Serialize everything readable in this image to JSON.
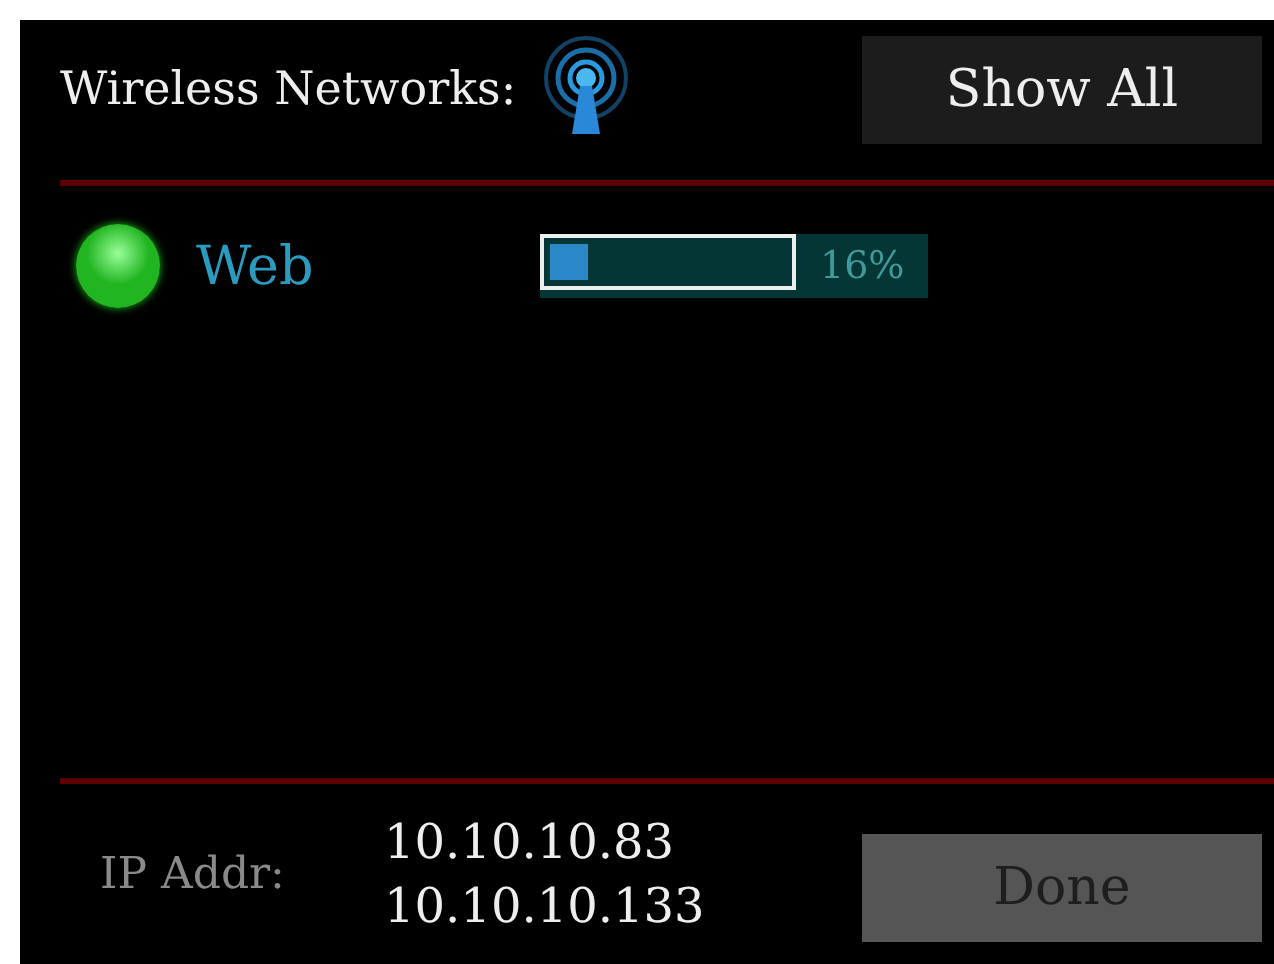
{
  "header": {
    "title": "Wireless Networks:",
    "button": "Show All"
  },
  "networks": [
    {
      "name": "Web",
      "color": "#22b522",
      "level": 0.16,
      "reading": "16%"
    }
  ],
  "footer": {
    "label": "IP Addr:",
    "addresses": [
      "10.10.10.83",
      "10.10.10.133"
    ],
    "button": {
      "label": "Done",
      "disabled": true
    }
  }
}
